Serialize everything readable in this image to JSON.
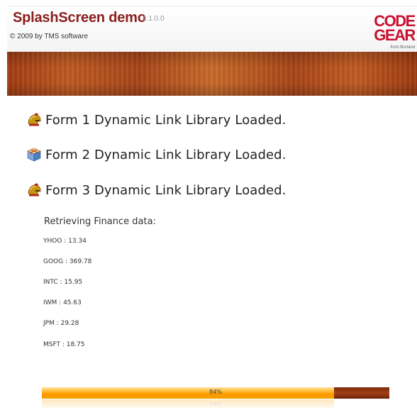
{
  "header": {
    "title": "SplashScreen demo",
    "version": "1.1.0.0",
    "copyright": "© 2009 by TMS software",
    "logo": {
      "line1": "CODE",
      "line2": "GEAR",
      "line3": "from Borland"
    }
  },
  "loaded": [
    {
      "icon": "helmet-icon",
      "text": "Form 1 Dynamic Link Library Loaded."
    },
    {
      "icon": "package-box-icon",
      "text": "Form 2 Dynamic Link Library Loaded."
    },
    {
      "icon": "helmet-icon",
      "text": "Form 3 Dynamic Link Library Loaded."
    }
  ],
  "finance": {
    "heading": "Retrieving Finance data:",
    "items": [
      "YHOO : 13.34",
      "GOOG : 369.78",
      "INTC : 15.95",
      "IWM : 45.63",
      "JPM : 29.28",
      "MSFT : 18.75"
    ]
  },
  "progress": {
    "value": 0.84,
    "label": "84%"
  },
  "colors": {
    "title": "#8b1d1d",
    "logo": "#c8102e",
    "progress_fill": "#ffa500",
    "progress_track": "#8a300c"
  }
}
